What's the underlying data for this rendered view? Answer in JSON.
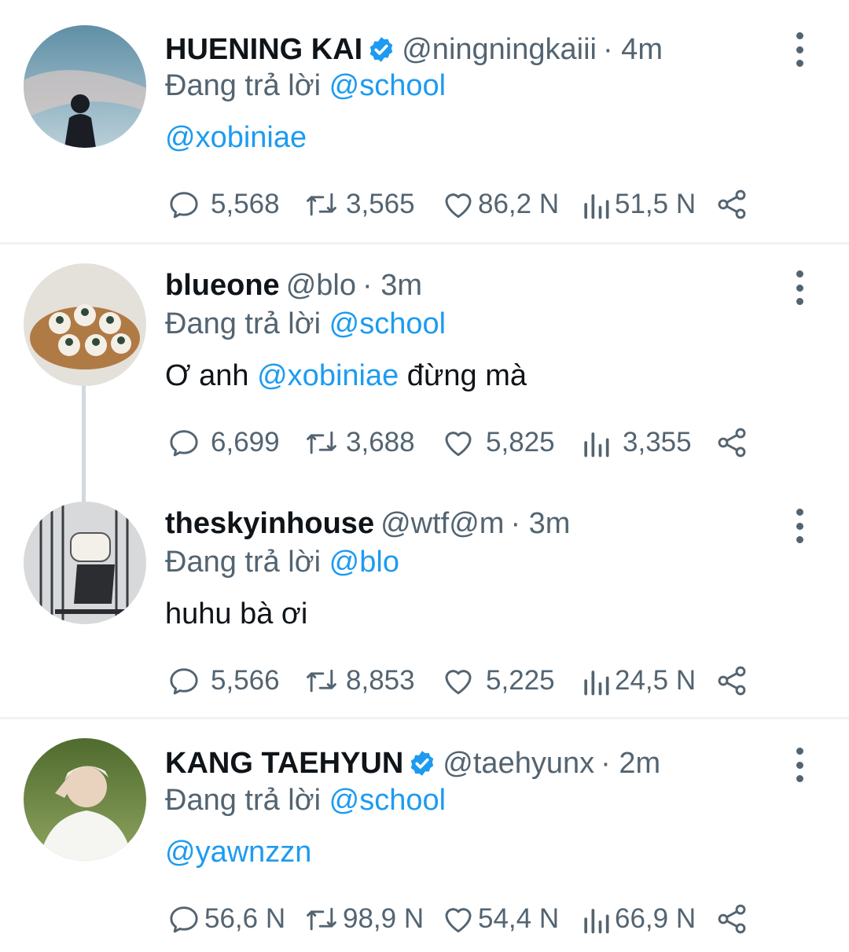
{
  "tweets": [
    {
      "name": "HUENING KAI",
      "verified": true,
      "handle": "@ningningkaiii",
      "time": "· 4m",
      "reply_prefix": "Đang trả lời",
      "reply_to": "@school",
      "body_pre": "",
      "body_mention": "@xobiniae",
      "body_post": "",
      "replies": "5,568",
      "retweets": "3,565",
      "likes": "86,2 N",
      "views": "51,5 N"
    },
    {
      "name": "blueone",
      "verified": false,
      "handle": "@blo",
      "time": "· 3m",
      "reply_prefix": "Đang trả lời",
      "reply_to": "@school",
      "body_pre": "Ơ anh ",
      "body_mention": "@xobiniae",
      "body_post": " đừng mà",
      "replies": "6,699",
      "retweets": "3,688",
      "likes": "5,825",
      "views": "3,355"
    },
    {
      "name": "theskyinhouse",
      "verified": false,
      "handle": "@wtf@m",
      "time": "· 3m",
      "reply_prefix": "Đang trả lời",
      "reply_to": "@blo",
      "body_pre": "huhu bà ơi",
      "body_mention": "",
      "body_post": "",
      "replies": "5,566",
      "retweets": "8,853",
      "likes": "5,225",
      "views": "24,5 N"
    },
    {
      "name": "KANG TAEHYUN",
      "verified": true,
      "handle": "@taehyunx",
      "time": "· 2m",
      "reply_prefix": "Đang trả lời",
      "reply_to": "@school",
      "body_pre": "",
      "body_mention": "@yawnzzn",
      "body_post": "",
      "replies": "56,6 N",
      "retweets": "98,9 N",
      "likes": "54,4 N",
      "views": "66,9 N"
    }
  ],
  "colors": {
    "accent": "#1d9bf0",
    "muted": "#536471",
    "text": "#0f1419",
    "divider": "#eff3f4"
  },
  "icons": [
    "verified-badge-icon",
    "more-vertical-icon",
    "reply-icon",
    "retweet-icon",
    "like-icon",
    "views-icon",
    "share-icon"
  ]
}
